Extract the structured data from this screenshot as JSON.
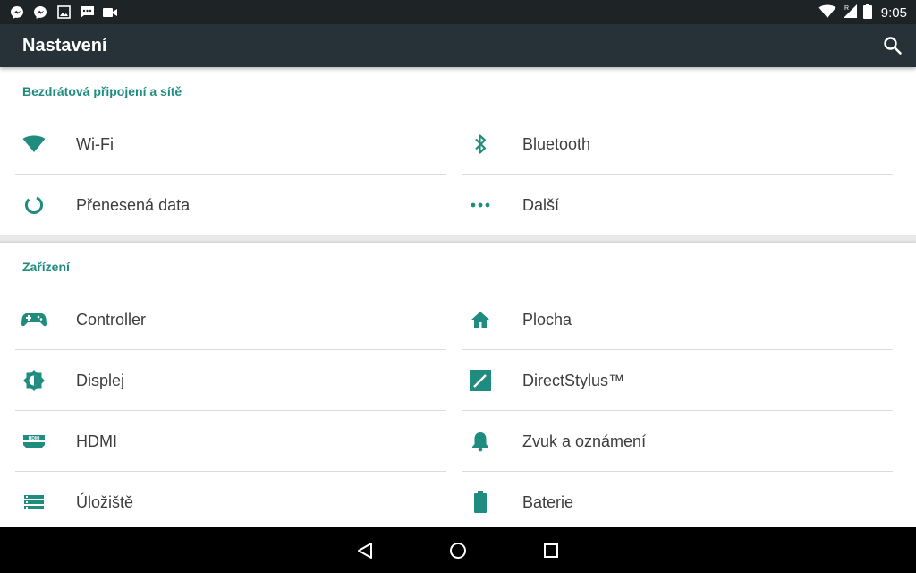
{
  "status_bar": {
    "time": "9:05",
    "left_icons": [
      "messenger-icon",
      "messenger-icon",
      "gallery-icon",
      "chat-icon",
      "video-icon"
    ],
    "right_icons": [
      "wifi-signal-icon",
      "cell-signal-roaming-icon",
      "battery-icon"
    ]
  },
  "toolbar": {
    "title": "Nastavení",
    "search_icon": "search-icon"
  },
  "sections": {
    "wireless": {
      "header": "Bezdrátová připojení a sítě",
      "items": [
        {
          "label": "Wi-Fi",
          "icon": "wifi-icon"
        },
        {
          "label": "Bluetooth",
          "icon": "bluetooth-icon"
        },
        {
          "label": "Přenesená data",
          "icon": "data-usage-icon"
        },
        {
          "label": "Další",
          "icon": "more-icon"
        }
      ]
    },
    "device": {
      "header": "Zařízení",
      "items": [
        {
          "label": "Controller",
          "icon": "gamepad-icon"
        },
        {
          "label": "Plocha",
          "icon": "home-icon"
        },
        {
          "label": "Displej",
          "icon": "brightness-icon"
        },
        {
          "label": "DirectStylus™",
          "icon": "stylus-icon"
        },
        {
          "label": "HDMI",
          "icon": "hdmi-icon"
        },
        {
          "label": "Zvuk a oznámení",
          "icon": "bell-icon"
        },
        {
          "label": "Úložiště",
          "icon": "storage-icon"
        },
        {
          "label": "Baterie",
          "icon": "battery-icon"
        }
      ]
    }
  },
  "nav_bar": {
    "buttons": [
      "back-icon",
      "home-icon",
      "recents-icon"
    ]
  },
  "colors": {
    "accent": "#1f8c7f",
    "toolbar": "#263238",
    "status_bar": "#1e2326"
  }
}
